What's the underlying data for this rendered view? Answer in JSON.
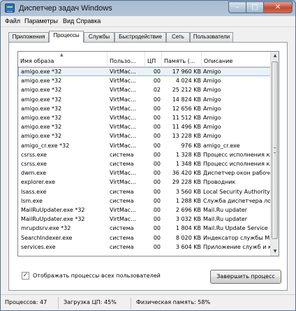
{
  "window": {
    "title": "Диспетчер задач Windows",
    "min_label": "–",
    "max_label": "□",
    "close_label": "✕"
  },
  "menu": [
    "Файл",
    "Параметры",
    "Вид",
    "Справка"
  ],
  "tabs": [
    "Приложения",
    "Процессы",
    "Службы",
    "Быстродействие",
    "Сеть",
    "Пользователи"
  ],
  "active_tab": "Процессы",
  "columns": [
    "Имя образа",
    "Пользо...",
    "ЦП",
    "Память (...",
    "Описание"
  ],
  "sort_indicator": "▲",
  "processes": [
    [
      "amigo.exe *32",
      "VirtMac...",
      "00",
      "17 960 KB",
      "Amigo"
    ],
    [
      "amigo.exe *32",
      "VirtMac...",
      "00",
      "4 024 KB",
      "Amigo"
    ],
    [
      "amigo.exe *32",
      "VirtMac...",
      "02",
      "25 212 KB",
      "Amigo"
    ],
    [
      "amigo.exe *32",
      "VirtMac...",
      "00",
      "14 824 KB",
      "Amigo"
    ],
    [
      "amigo.exe *32",
      "VirtMac...",
      "00",
      "12 656 KB",
      "Amigo"
    ],
    [
      "amigo.exe *32",
      "VirtMac...",
      "00",
      "11 512 KB",
      "Amigo"
    ],
    [
      "amigo.exe *32",
      "VirtMac...",
      "00",
      "11 496 KB",
      "Amigo"
    ],
    [
      "amigo.exe *32",
      "VirtMac...",
      "00",
      "13 228 KB",
      "Amigo"
    ],
    [
      "amigo_cr.exe *32",
      "VirtMac...",
      "00",
      "976 KB",
      "amigo_cr.exe"
    ],
    [
      "csrss.exe",
      "система",
      "00",
      "1 328 KB",
      "Процесс исполнения кли..."
    ],
    [
      "csrss.exe",
      "система",
      "00",
      "1 348 KB",
      "Процесс исполнения кли..."
    ],
    [
      "dwm.exe",
      "VirtMac...",
      "00",
      "36 420 KB",
      "Диспетчер окон рабочего..."
    ],
    [
      "explorer.exe",
      "VirtMac...",
      "00",
      "29 228 KB",
      "Проводник"
    ],
    [
      "lsass.exe",
      "система",
      "00",
      "3 560 KB",
      "Local Security Authority Pr..."
    ],
    [
      "lsm.exe",
      "система",
      "00",
      "1 288 KB",
      "Служба диспетчера лока..."
    ],
    [
      "MailRuUpdater.exe *32",
      "VirtMac...",
      "00",
      "2 696 KB",
      "Mail.Ru updater"
    ],
    [
      "MailRuUpdater.exe *32",
      "VirtMac...",
      "00",
      "3 032 KB",
      "Mail.Ru updater"
    ],
    [
      "mrupdsrv.exe *32",
      "система",
      "00",
      "1 804 KB",
      "Mail.Ru Update Service"
    ],
    [
      "SearchIndexer.exe",
      "система",
      "00",
      "8 020 KB",
      "Индексатор службы Micr..."
    ],
    [
      "services.exe",
      "система",
      "00",
      "3 604 KB",
      "Приложение служб и кон..."
    ]
  ],
  "show_all_label": "Отображать процессы всех пользователей",
  "show_all_checked": "✓",
  "end_process_label": "Завершить процесс",
  "scroll_up": "▲",
  "scroll_down": "▼",
  "status": {
    "processes": "Процессов: 47",
    "cpu": "Загрузка ЦП: 45%",
    "memory": "Физическая память: 58%"
  }
}
